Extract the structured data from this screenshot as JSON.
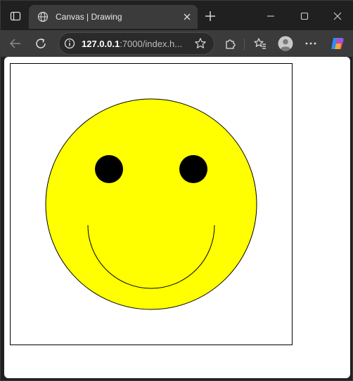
{
  "browser": {
    "tab": {
      "title": "Canvas | Drawing",
      "favicon": "globe-icon"
    },
    "address": {
      "host": "127.0.0.1",
      "rest": ":7000/index.h..."
    },
    "icons": {
      "tab_actions": "tab-actions-icon",
      "close_tab": "close-icon",
      "new_tab": "plus-icon",
      "minimize": "minimize-icon",
      "maximize": "maximize-icon",
      "close_window": "close-icon",
      "back": "back-arrow-icon",
      "refresh": "refresh-icon",
      "site_info": "info-icon",
      "favorite": "star-icon",
      "extensions": "puzzle-icon",
      "favorites": "favorites-icon",
      "profile": "profile-icon",
      "more": "more-icon",
      "copilot": "copilot-icon"
    }
  },
  "drawing": {
    "shape": "smiley-face",
    "face_fill": "#ffff00",
    "outline": "#000000",
    "eye_fill": "#000000",
    "background": "#ffffff"
  }
}
